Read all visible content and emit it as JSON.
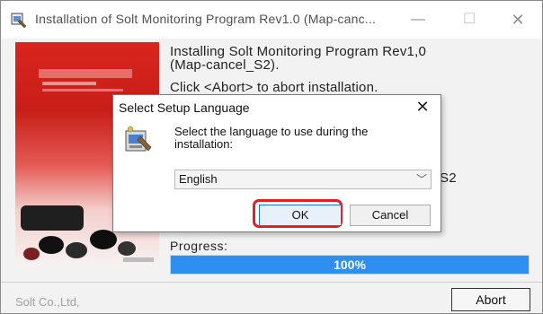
{
  "window": {
    "title": "Installation of Solt Monitoring Program Rev1.0 (Map-canc...",
    "minimize": "—",
    "maximize": "☐",
    "close": "✕"
  },
  "main": {
    "line1": "Installing Solt Monitoring Program Rev1,0",
    "line2": "(Map-cancel_S2).",
    "line3": "Click <Abort> to abort installation.",
    "partial_path": "S2",
    "progress_label": "Progress:",
    "progress_value": "100%",
    "progress_fraction": 1.0
  },
  "footer": {
    "company": "Solt Co.,Ltd,",
    "abort_label": "Abort"
  },
  "dialog": {
    "title": "Select Setup Language",
    "close": "✕",
    "message": "Select the language to use during the installation:",
    "language_selected": "English",
    "ok_label": "OK",
    "cancel_label": "Cancel"
  },
  "colors": {
    "progress": "#2f8ff0",
    "highlight": "#e21e24",
    "side_image": "#d9261e"
  }
}
